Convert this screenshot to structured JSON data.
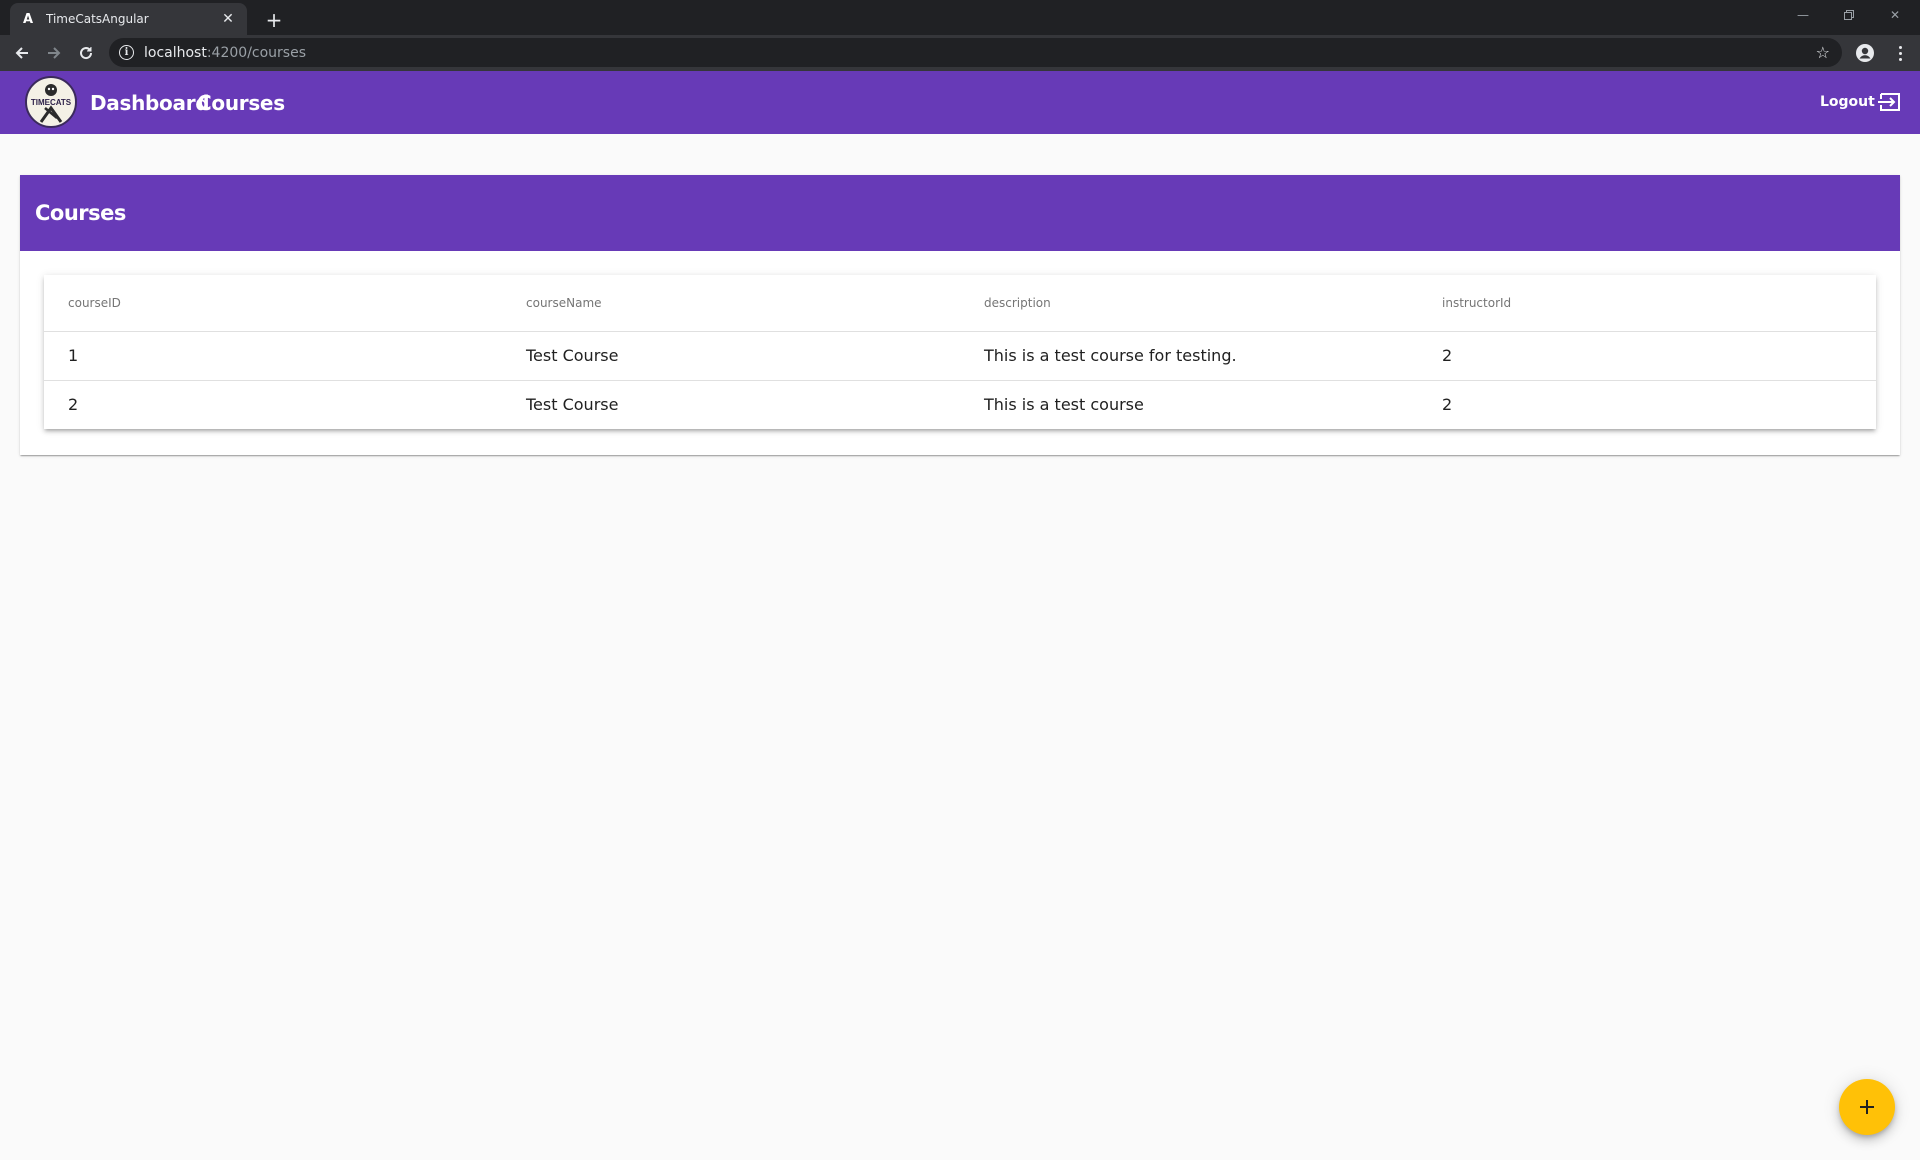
{
  "browser": {
    "tab_title": "TimeCatsAngular",
    "tab_favicon": "A",
    "tab_close": "✕",
    "new_tab": "+",
    "url_host": "localhost",
    "url_path": ":4200/courses"
  },
  "toolbar": {
    "logo_text": "TIMECATS",
    "nav": [
      "Dashboard",
      "Courses"
    ],
    "logout_label": "Logout"
  },
  "card": {
    "title": "Courses"
  },
  "table": {
    "columns": [
      "courseID",
      "courseName",
      "description",
      "instructorId"
    ],
    "rows": [
      [
        "1",
        "Test Course",
        "This is a test course for testing.",
        "2"
      ],
      [
        "2",
        "Test Course",
        "This is a test course",
        "2"
      ]
    ]
  },
  "colors": {
    "primary": "#673ab7",
    "accent": "#ffc107"
  },
  "icons": {
    "fab": "plus-icon",
    "logout": "exit-arrow-icon"
  }
}
